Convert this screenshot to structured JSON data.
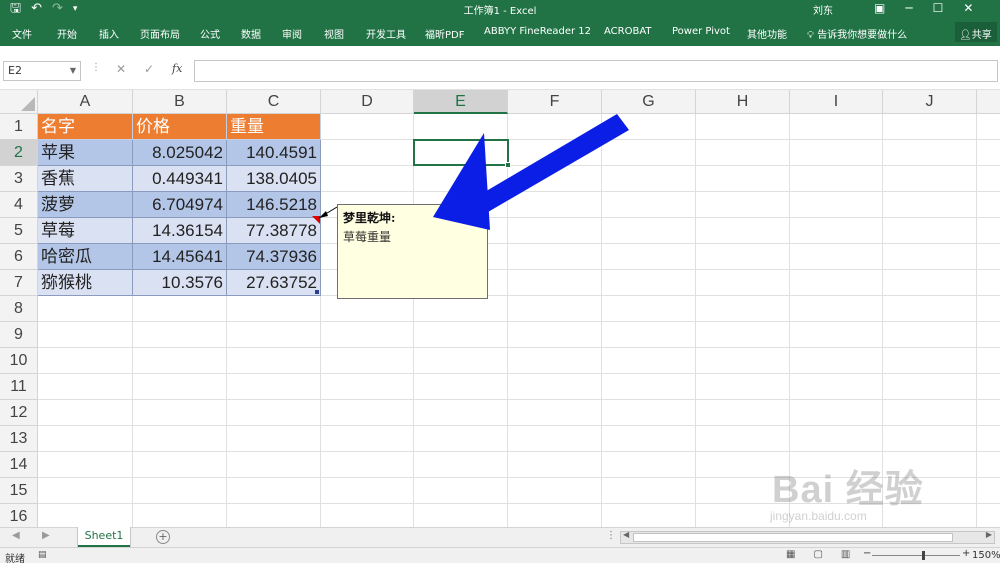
{
  "window": {
    "title": "工作簿1 - Excel",
    "user": "刘东"
  },
  "ribbon": {
    "tabs": [
      "文件",
      "开始",
      "插入",
      "页面布局",
      "公式",
      "数据",
      "审阅",
      "视图",
      "开发工具",
      "福昕PDF",
      "ABBYY FineReader 12",
      "ACROBAT",
      "Power Pivot",
      "其他功能"
    ],
    "tell_me": "告诉我你想要做什么",
    "share": "共享"
  },
  "formula_bar": {
    "name_box": "E2",
    "fx_label": "fx",
    "formula": ""
  },
  "columns": [
    "A",
    "B",
    "C",
    "D",
    "E",
    "F",
    "G",
    "H",
    "I",
    "J"
  ],
  "rows": [
    "1",
    "2",
    "3",
    "4",
    "5",
    "6",
    "7",
    "8",
    "9",
    "10",
    "11",
    "12",
    "13",
    "14",
    "15",
    "16"
  ],
  "table": {
    "headers": [
      "名字",
      "价格",
      "重量"
    ],
    "rows": [
      [
        "苹果",
        "8.025042",
        "140.4591"
      ],
      [
        "香蕉",
        "0.449341",
        "138.0405"
      ],
      [
        "菠萝",
        "6.704974",
        "146.5218"
      ],
      [
        "草莓",
        "14.36154",
        "77.38778"
      ],
      [
        "哈密瓜",
        "14.45641",
        "74.37936"
      ],
      [
        "猕猴桃",
        "10.3576",
        "27.63752"
      ]
    ]
  },
  "comment": {
    "author": "梦里乾坤:",
    "text": "草莓重量"
  },
  "sheets": [
    "Sheet1"
  ],
  "status": {
    "ready": "就绪",
    "zoom": "150%"
  },
  "watermark": {
    "brand": "Bai 经验",
    "url": "jingyan.baidu.com"
  },
  "colors": {
    "excel_green": "#217346",
    "header_orange": "#ed7d31",
    "band_dark": "#b4c6e7",
    "band_light": "#d9e1f2",
    "arrow_blue": "#0a1ee6",
    "comment_bg": "#ffffe1"
  }
}
